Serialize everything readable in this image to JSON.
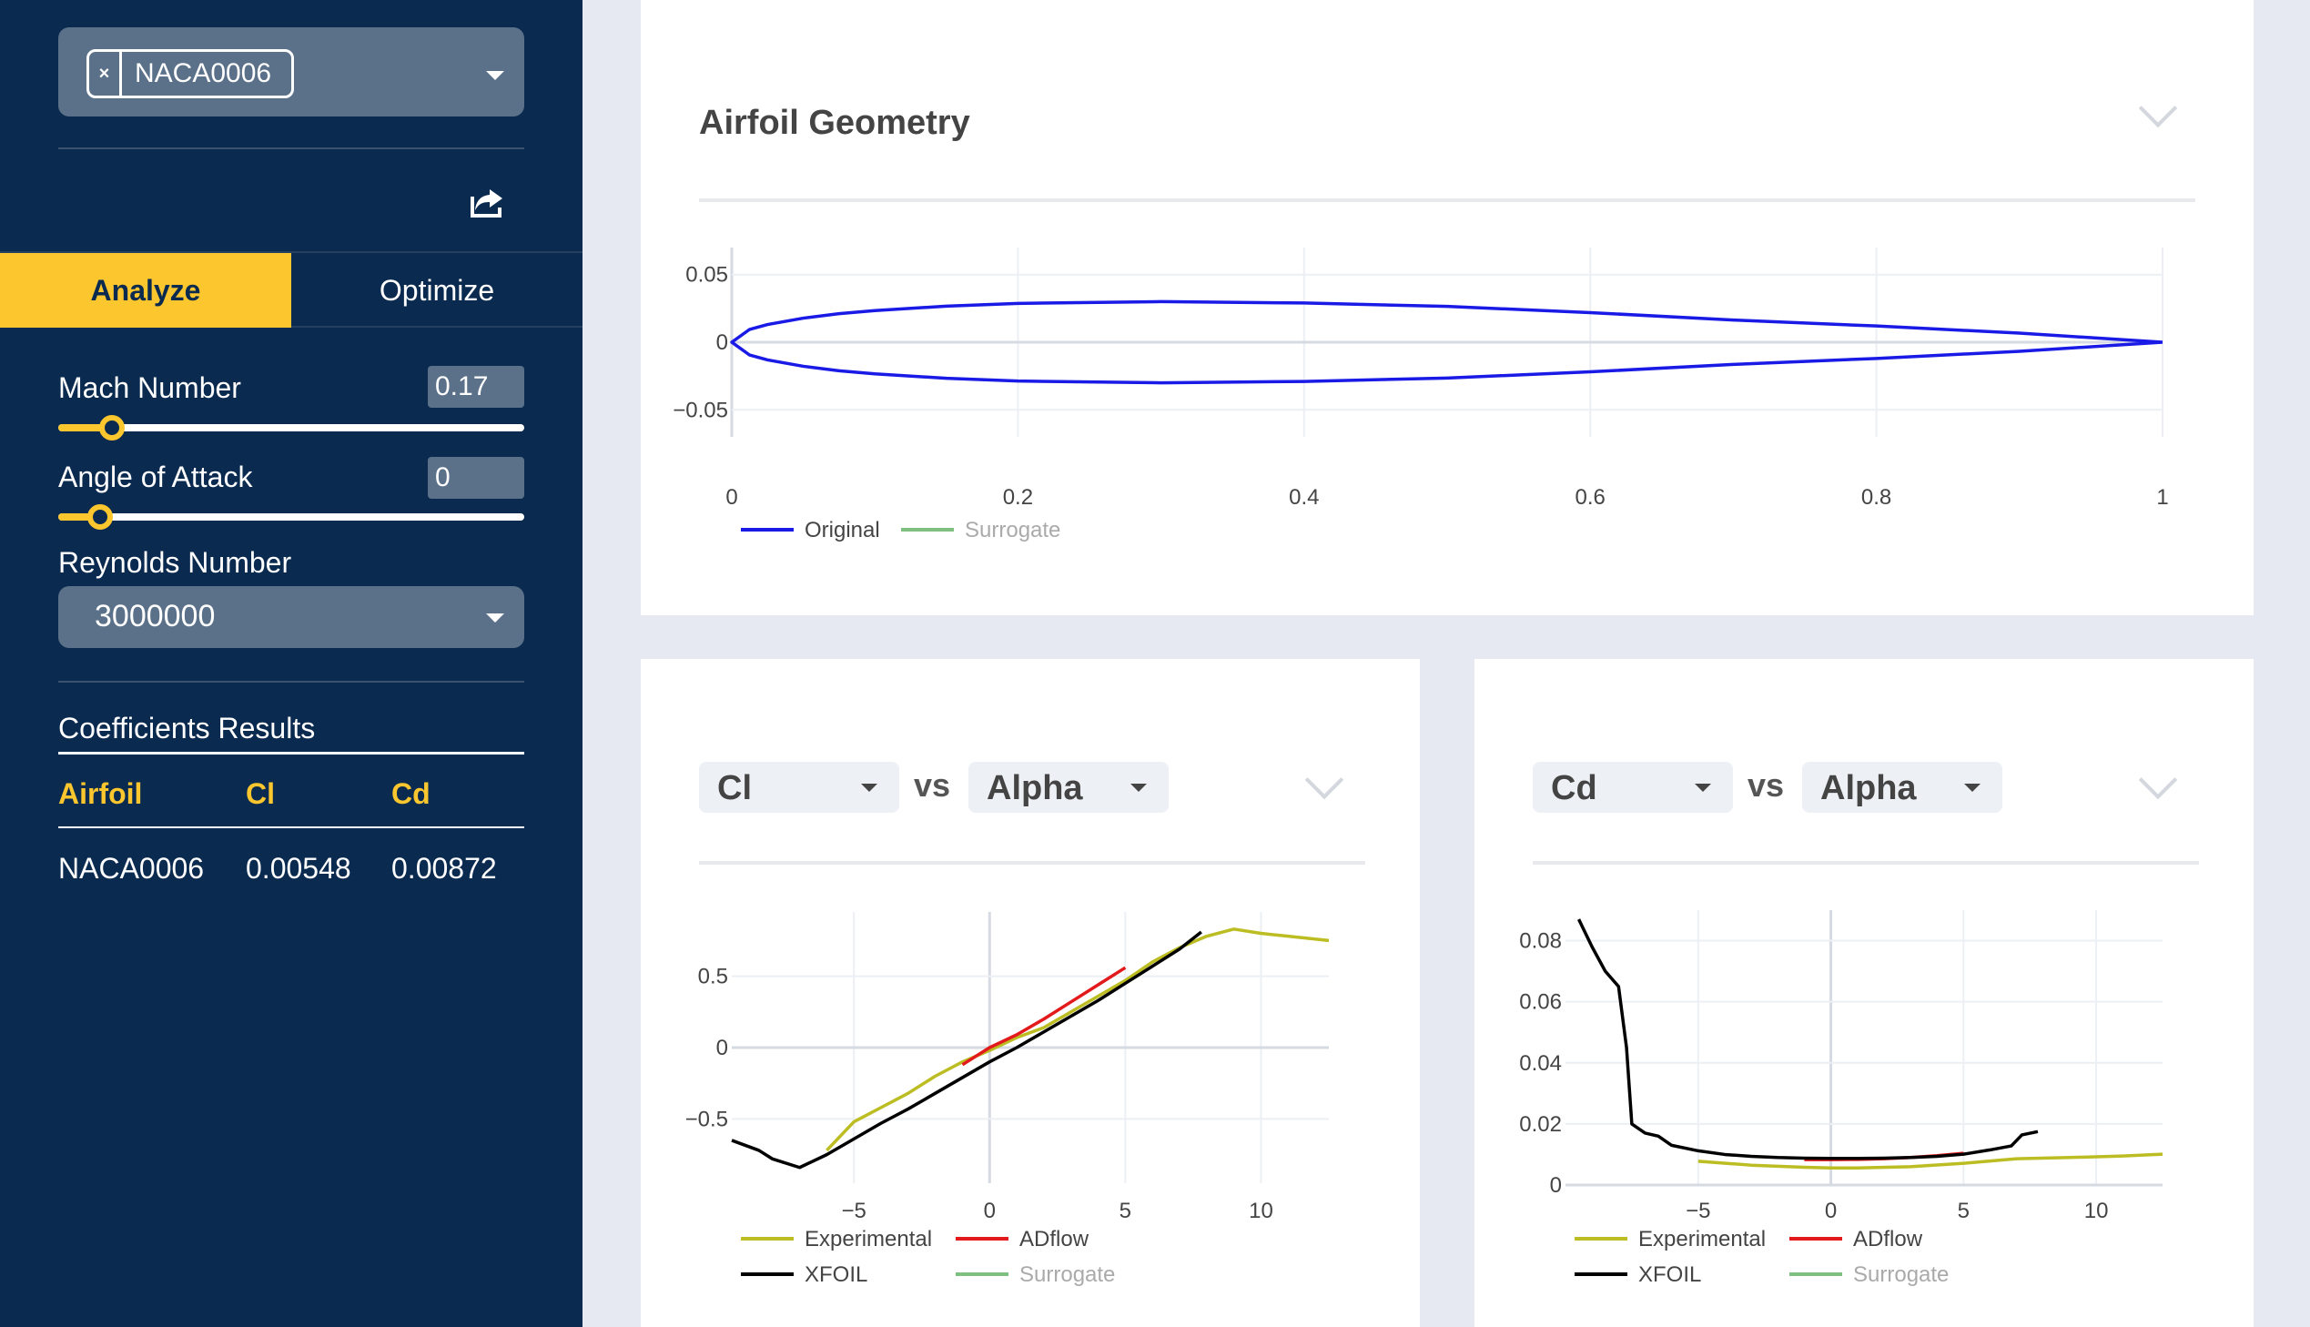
{
  "sidebar": {
    "airfoil_chip": "NACA0006",
    "chip_remove": "×",
    "tabs": [
      {
        "label": "Analyze",
        "active": true
      },
      {
        "label": "Optimize",
        "active": false
      }
    ],
    "mach": {
      "label": "Mach Number",
      "value": "0.17",
      "slider_fraction": 0.115
    },
    "aoa": {
      "label": "Angle of Attack",
      "value": "0",
      "slider_fraction": 0.09
    },
    "reynolds": {
      "label": "Reynolds Number",
      "value": "3000000"
    },
    "results": {
      "title": "Coefficients Results",
      "headers": [
        "Airfoil",
        "Cl",
        "Cd"
      ],
      "rows": [
        [
          "NACA0006",
          "0.00548",
          "0.00872"
        ]
      ]
    }
  },
  "geometry_card": {
    "title": "Airfoil Geometry"
  },
  "cl_card": {
    "y_select": "Cl",
    "vs": "vs",
    "x_select": "Alpha"
  },
  "cd_card": {
    "y_select": "Cd",
    "vs": "vs",
    "x_select": "Alpha"
  },
  "colors": {
    "accent": "#fbc62e",
    "sidebar": "#0a2a4f",
    "original": "#1a1ae6",
    "experimental": "#bcbd22",
    "adflow": "#e31a1c",
    "xfoil": "#000000",
    "surrogate": "#7fbf7f"
  },
  "chart_data": [
    {
      "type": "line",
      "xlim": [
        0,
        1
      ],
      "ylim": [
        -0.07,
        0.07
      ],
      "xticks": [
        "0",
        "0.2",
        "0.4",
        "0.6",
        "0.8",
        "1"
      ],
      "yticks": [
        "0.05",
        "0",
        "−0.05"
      ],
      "grid": true,
      "legend": "bottom-left",
      "series": [
        {
          "name": "Original",
          "x": [
            1,
            0.9,
            0.8,
            0.7,
            0.6,
            0.5,
            0.4,
            0.3,
            0.2,
            0.15,
            0.1,
            0.075,
            0.05,
            0.025,
            0.0125,
            0,
            0.0125,
            0.025,
            0.05,
            0.075,
            0.1,
            0.15,
            0.2,
            0.3,
            0.4,
            0.5,
            0.6,
            0.7,
            0.8,
            0.9,
            1
          ],
          "y": [
            0,
            0.0067,
            0.012,
            0.0164,
            0.0219,
            0.0265,
            0.029,
            0.03,
            0.0287,
            0.0267,
            0.0234,
            0.0211,
            0.0178,
            0.0131,
            0.0095,
            0,
            -0.0095,
            -0.0131,
            -0.0178,
            -0.0211,
            -0.0234,
            -0.0267,
            -0.0287,
            -0.03,
            -0.029,
            -0.0265,
            -0.0219,
            -0.0164,
            -0.012,
            -0.0067,
            0
          ]
        },
        {
          "name": "Surrogate",
          "x": [],
          "y": []
        }
      ]
    },
    {
      "type": "line",
      "xlim": [
        -9.5,
        12.5
      ],
      "ylim": [
        -0.95,
        0.95
      ],
      "xticks": [
        "−5",
        "0",
        "5",
        "10"
      ],
      "yticks": [
        "0.5",
        "0",
        "−0.5"
      ],
      "grid": true,
      "legend": "bottom-left",
      "series": [
        {
          "name": "Experimental",
          "x": [
            -6,
            -5,
            -4,
            -3,
            -2,
            -1,
            0,
            1,
            2,
            3,
            4,
            5,
            6,
            7,
            8,
            9,
            10,
            11,
            12.5
          ],
          "y": [
            -0.72,
            -0.52,
            -0.42,
            -0.32,
            -0.2,
            -0.1,
            -0.02,
            0.07,
            0.14,
            0.25,
            0.36,
            0.47,
            0.6,
            0.7,
            0.78,
            0.83,
            0.8,
            0.78,
            0.75
          ]
        },
        {
          "name": "ADflow",
          "x": [
            -1,
            0,
            1,
            2,
            3,
            4,
            5
          ],
          "y": [
            -0.12,
            0,
            0.09,
            0.2,
            0.32,
            0.44,
            0.56
          ]
        },
        {
          "name": "XFOIL",
          "x": [
            -9.5,
            -8.5,
            -8,
            -7,
            -6,
            -5,
            -4,
            -3,
            -2,
            -1,
            0,
            1,
            2,
            3,
            4,
            5,
            6,
            7,
            7.8
          ],
          "y": [
            -0.65,
            -0.72,
            -0.78,
            -0.84,
            -0.75,
            -0.64,
            -0.53,
            -0.43,
            -0.32,
            -0.21,
            -0.1,
            0,
            0.11,
            0.22,
            0.33,
            0.45,
            0.57,
            0.69,
            0.81
          ]
        },
        {
          "name": "Surrogate",
          "x": [],
          "y": []
        }
      ]
    },
    {
      "type": "line",
      "xlim": [
        -10,
        12.5
      ],
      "ylim": [
        0,
        0.09
      ],
      "xticks": [
        "−5",
        "0",
        "5",
        "10"
      ],
      "yticks": [
        "0.08",
        "0.06",
        "0.04",
        "0.02",
        "0"
      ],
      "grid": true,
      "legend": "bottom-left",
      "series": [
        {
          "name": "Experimental",
          "x": [
            -5,
            -3,
            -1,
            0,
            1,
            3,
            5,
            7,
            9,
            11,
            12.5
          ],
          "y": [
            0.0078,
            0.0065,
            0.0058,
            0.0056,
            0.0056,
            0.006,
            0.0071,
            0.0086,
            0.009,
            0.0095,
            0.0101
          ]
        },
        {
          "name": "ADflow",
          "x": [
            -1,
            0,
            1,
            2,
            3,
            4,
            5
          ],
          "y": [
            0.0083,
            0.0083,
            0.0084,
            0.0086,
            0.009,
            0.0096,
            0.0104
          ]
        },
        {
          "name": "XFOIL",
          "x": [
            -9.5,
            -9,
            -8.5,
            -8,
            -7.7,
            -7.5,
            -7,
            -6.5,
            -6,
            -5,
            -4,
            -3,
            -2,
            -1,
            0,
            1,
            2,
            3,
            4,
            5,
            6,
            6.8,
            7.2,
            7.8
          ],
          "y": [
            0.087,
            0.078,
            0.07,
            0.065,
            0.045,
            0.02,
            0.017,
            0.016,
            0.013,
            0.0112,
            0.01,
            0.0094,
            0.009,
            0.0088,
            0.0087,
            0.0087,
            0.0088,
            0.009,
            0.0094,
            0.0101,
            0.0115,
            0.0128,
            0.0164,
            0.0175
          ]
        },
        {
          "name": "Surrogate",
          "x": [],
          "y": []
        }
      ]
    }
  ]
}
